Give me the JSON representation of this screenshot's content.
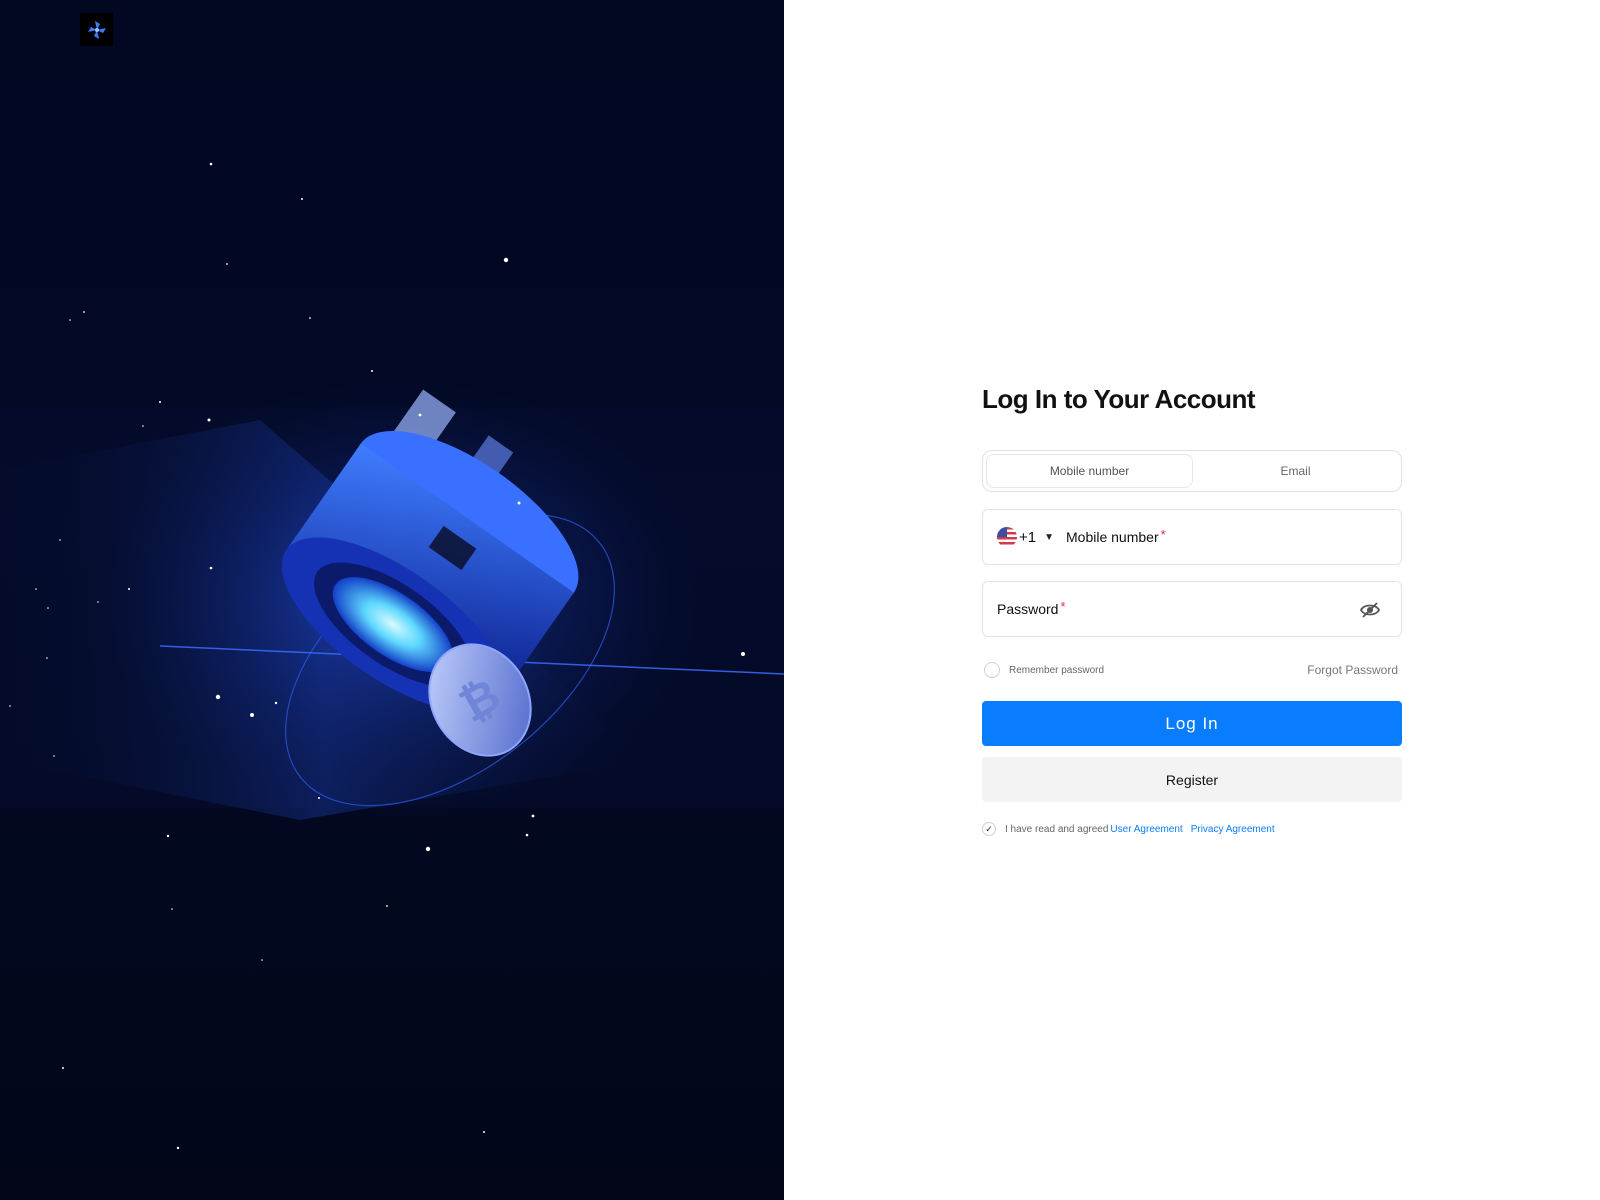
{
  "form": {
    "title": "Log In to Your Account",
    "tabs": [
      {
        "label": "Mobile number",
        "active": true
      },
      {
        "label": "Email",
        "active": false
      }
    ],
    "mobile": {
      "dial_code": "+1",
      "caret": "▼",
      "label": "Mobile number",
      "required_mark": "*"
    },
    "password": {
      "label": "Password",
      "required_mark": "*"
    },
    "remember_label": "Remember password",
    "forgot_label": "Forgot Password",
    "login_label": "Log In",
    "register_label": "Register",
    "agreement": {
      "check_glyph": "✓",
      "text": "I have read and agreed",
      "user_agreement": "User Agreement",
      "privacy_agreement": "Privacy Agreement"
    }
  },
  "icons": {
    "logo": "pinwheel-logo-icon",
    "flag": "us-flag-icon",
    "eye": "eye-hidden-icon"
  },
  "colors": {
    "primary": "#0a7dff",
    "required": "#e0284b",
    "hero_bg": "#020722"
  }
}
